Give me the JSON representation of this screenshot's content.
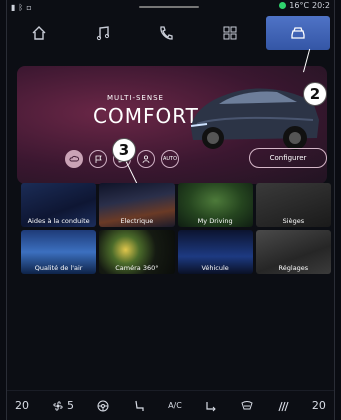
{
  "status": {
    "temperature": "16°C",
    "time": "20:2"
  },
  "nav": {
    "items": [
      "home-icon",
      "music-icon",
      "phone-icon",
      "apps-icon",
      "car-icon"
    ],
    "active": 4
  },
  "hero": {
    "subtitle": "MULTI-SENSE",
    "title": "COMFORT",
    "configure_label": "Configurer",
    "mode_auto": "AUTO"
  },
  "callouts": {
    "c2": "2",
    "c3": "3"
  },
  "tiles": [
    {
      "label": "Aides à la conduite"
    },
    {
      "label": "Electrique"
    },
    {
      "label": "My Driving"
    },
    {
      "label": "Sièges"
    },
    {
      "label": "Qualité de l'air"
    },
    {
      "label": "Caméra 360°"
    },
    {
      "label": "Véhicule"
    },
    {
      "label": "Réglages"
    }
  ],
  "bottom": {
    "left_temp": "20",
    "fan_level": "5",
    "ac_label": "A/C",
    "right_temp": "20"
  }
}
